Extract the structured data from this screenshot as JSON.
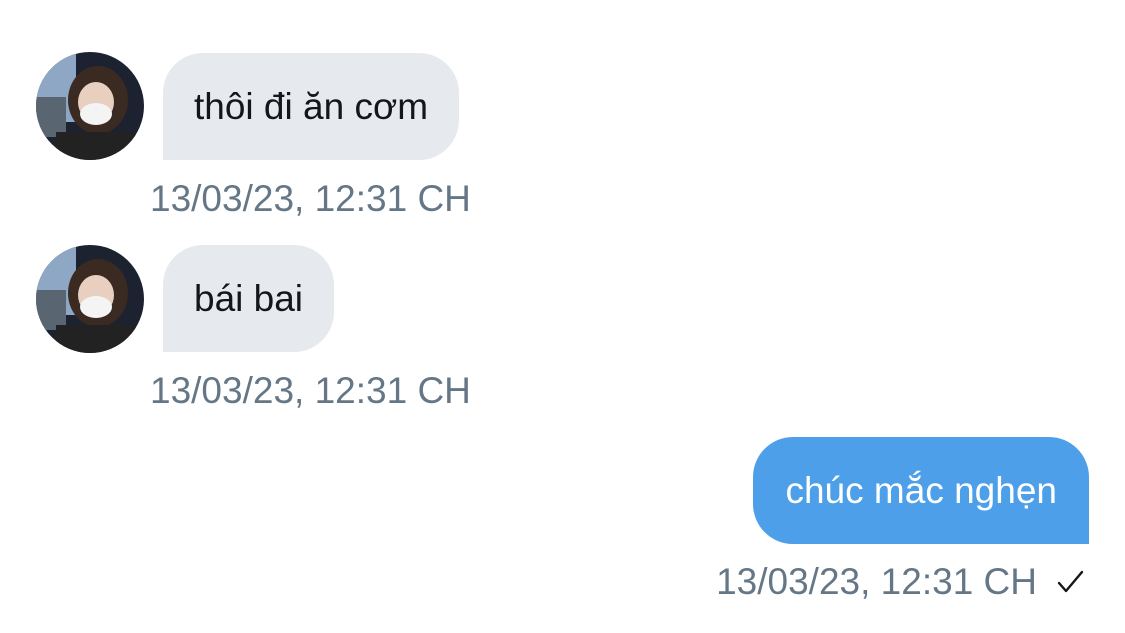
{
  "conversation": {
    "messages": [
      {
        "direction": "incoming",
        "text": "thôi đi ăn cơm",
        "timestamp": "13/03/23, 12:31 CH"
      },
      {
        "direction": "incoming",
        "text": "bái bai",
        "timestamp": "13/03/23, 12:31 CH"
      },
      {
        "direction": "outgoing",
        "text": "chúc mắc nghẹn",
        "timestamp": "13/03/23, 12:31 CH",
        "status_icon": "checkmark-icon"
      }
    ]
  },
  "colors": {
    "incoming_bubble": "#e6e9ed",
    "outgoing_bubble": "#4c9fe8",
    "timestamp": "#657786"
  }
}
